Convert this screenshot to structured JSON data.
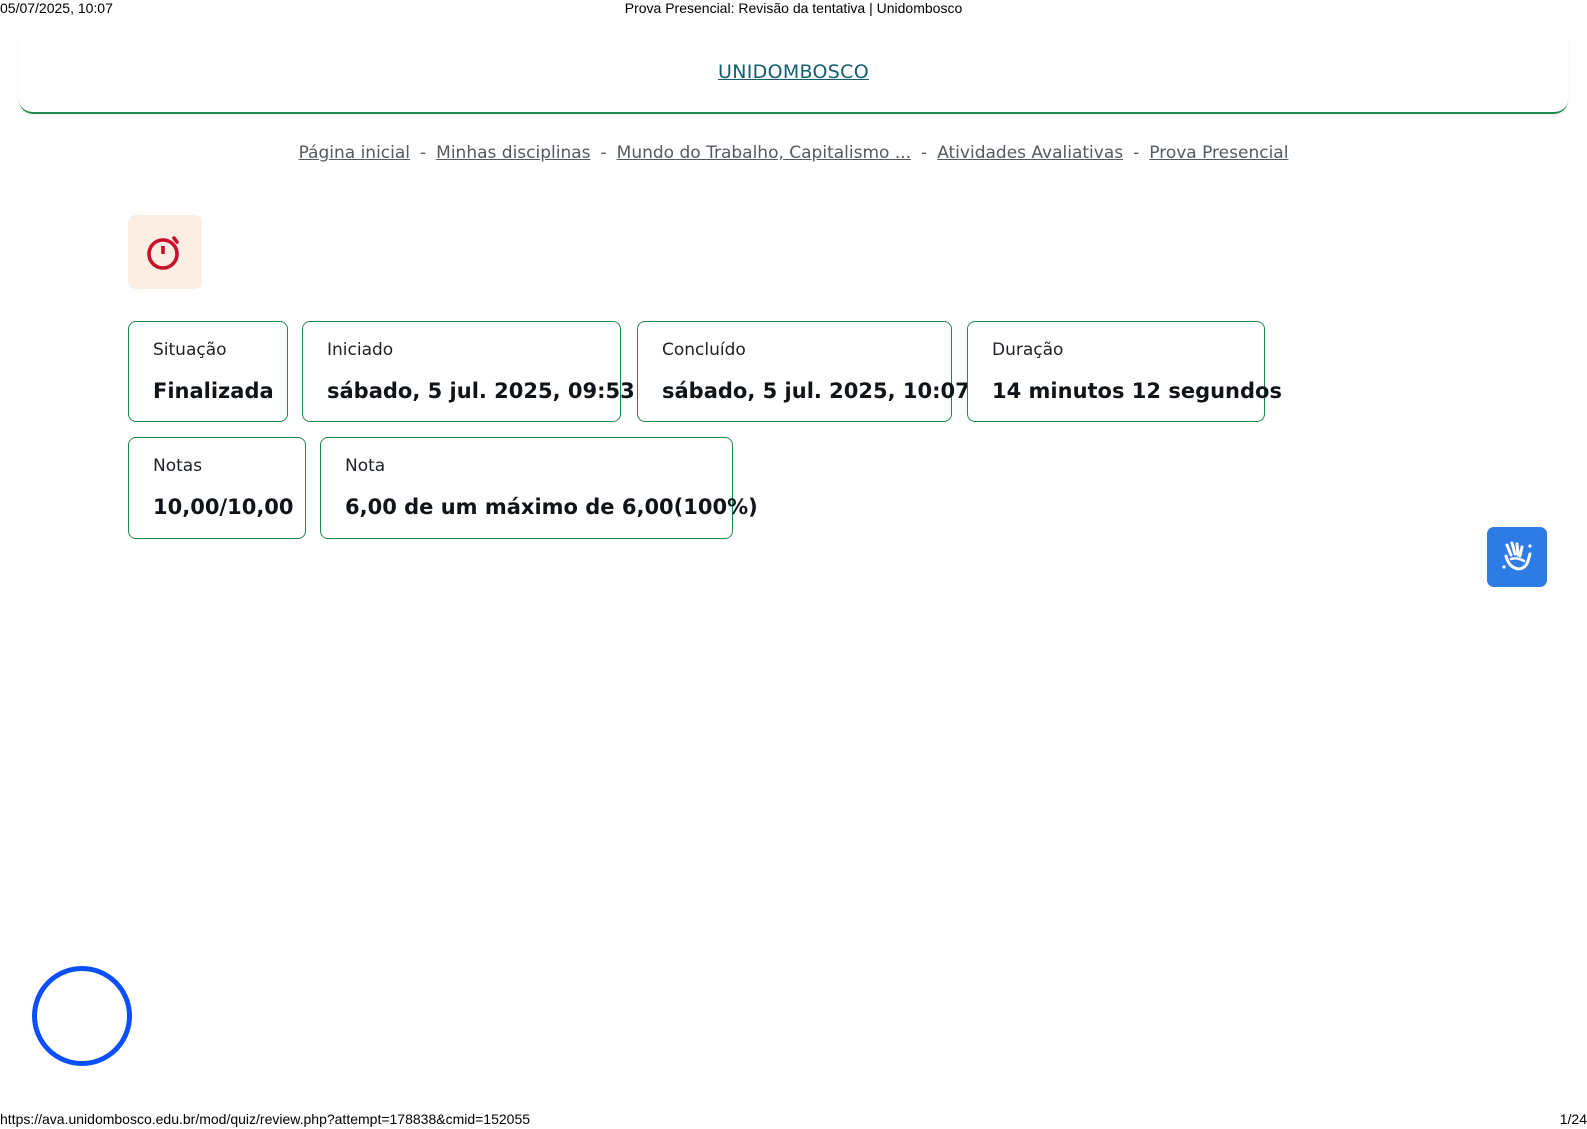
{
  "print_header": {
    "datetime": "05/07/2025, 10:07",
    "title": "Prova Presencial: Revisão da tentativa | Unidombosco"
  },
  "brand": {
    "name": "UNIDOMBOSCO"
  },
  "breadcrumb": {
    "items": [
      {
        "label": "Página inicial"
      },
      {
        "label": "Minhas disciplinas"
      },
      {
        "label": "Mundo do Trabalho, Capitalismo ..."
      },
      {
        "label": "Atividades Avaliativas"
      },
      {
        "label": "Prova Presencial"
      }
    ],
    "separator": "-"
  },
  "quiz_icon": {
    "icon": "stopwatch-icon",
    "color": "#c8102e",
    "background": "#fdeee3"
  },
  "summary": {
    "situacao": {
      "label": "Situação",
      "value": "Finalizada"
    },
    "iniciado": {
      "label": "Iniciado",
      "value": "sábado, 5 jul. 2025, 09:53"
    },
    "concluido": {
      "label": "Concluído",
      "value": "sábado, 5 jul. 2025, 10:07"
    },
    "duracao": {
      "label": "Duração",
      "value": "14 minutos 12 segundos"
    },
    "notas": {
      "label": "Notas",
      "value": "10,00/10,00"
    },
    "nota": {
      "label": "Nota",
      "value": "6,00 de um máximo de 6,00(100%)"
    }
  },
  "accessibility_widget": {
    "icon": "sign-language-hands-icon",
    "color": "#2d7be5"
  },
  "loader": {
    "icon": "loading-ring-icon",
    "color": "#0b4fff"
  },
  "print_footer": {
    "url": "https://ava.unidombosco.edu.br/mod/quiz/review.php?attempt=178838&cmid=152055",
    "page": "1/24"
  },
  "colors": {
    "accent_border": "#1e8a4a",
    "brand_link": "#145d73"
  }
}
